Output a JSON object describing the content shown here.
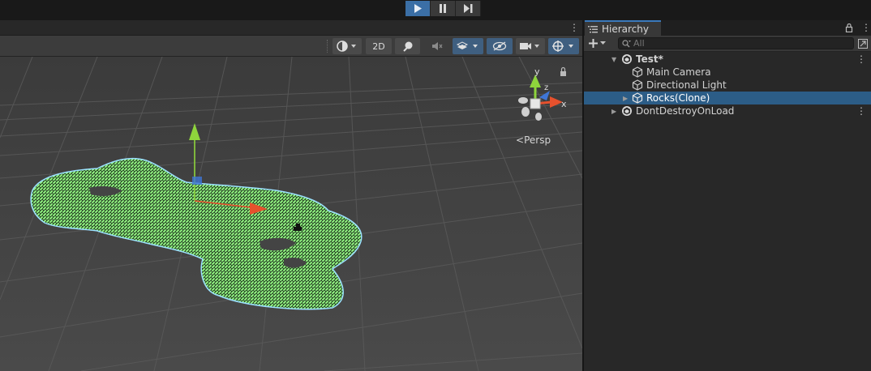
{
  "play_controls": {
    "play": "play-icon",
    "pause": "pause-icon",
    "step": "step-icon"
  },
  "scene": {
    "toolbar": {
      "mode_2d": "2D"
    },
    "gizmo": {
      "y_label": "y",
      "x_label": "x",
      "z_label": "z",
      "projection": "Persp"
    }
  },
  "hierarchy": {
    "tab_title": "Hierarchy",
    "search_placeholder": "All",
    "items": [
      {
        "label": "Test*",
        "bold": true
      },
      {
        "label": "Main Camera"
      },
      {
        "label": "Directional Light"
      },
      {
        "label": "Rocks(Clone)",
        "selected": true
      },
      {
        "label": "DontDestroyOnLoad"
      }
    ]
  },
  "colors": {
    "play_active": "#3b6fa6",
    "selection": "#2c5d87",
    "mesh_selected": "#8ef07e",
    "axis_x": "#e6512d",
    "axis_y": "#8ed43c",
    "axis_z": "#3f76d6"
  }
}
